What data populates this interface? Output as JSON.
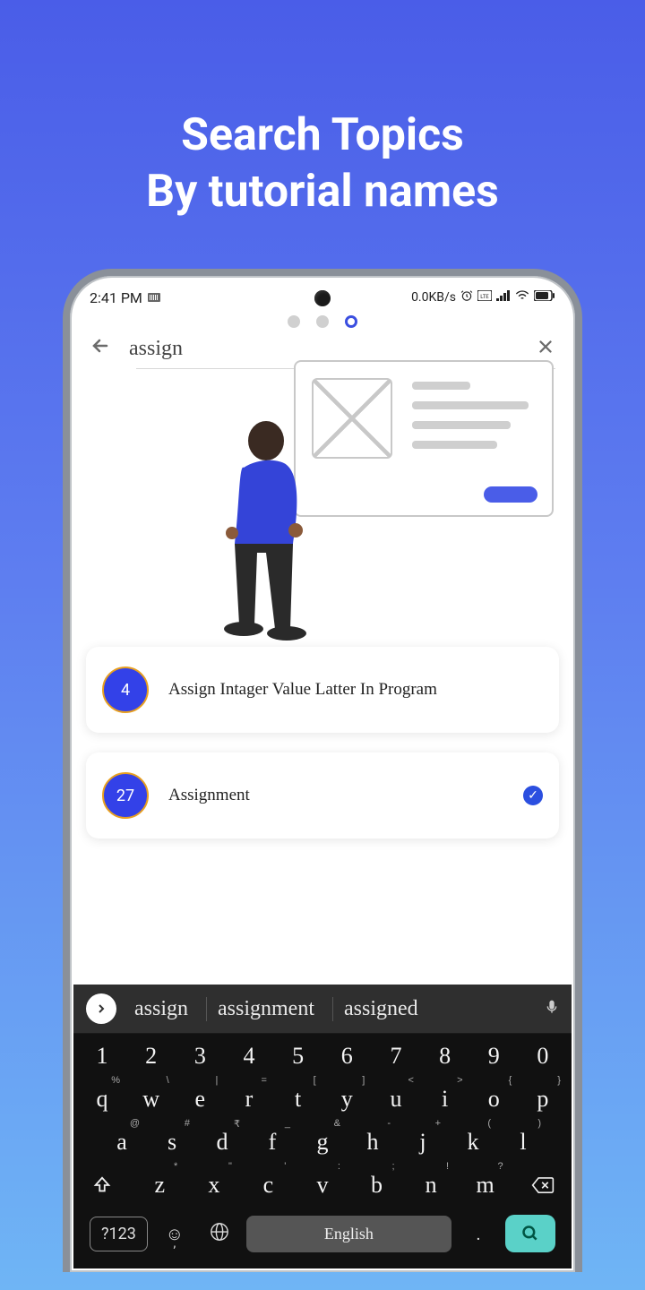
{
  "promo": {
    "line1": "Search Topics",
    "line2": "By tutorial names"
  },
  "status": {
    "time": "2:41 PM",
    "net": "0.0KB/s"
  },
  "search": {
    "query": "assign"
  },
  "results": [
    {
      "num": "4",
      "title": "Assign Intager Value Latter In Program",
      "done": false
    },
    {
      "num": "27",
      "title": "Assignment",
      "done": true
    }
  ],
  "suggest": [
    "assign",
    "assignment",
    "assigned"
  ],
  "kb": {
    "row_num": [
      "1",
      "2",
      "3",
      "4",
      "5",
      "6",
      "7",
      "8",
      "9",
      "0"
    ],
    "row1": [
      {
        "k": "q",
        "s": "%"
      },
      {
        "k": "w",
        "s": "\\"
      },
      {
        "k": "e",
        "s": "|"
      },
      {
        "k": "r",
        "s": "="
      },
      {
        "k": "t",
        "s": "["
      },
      {
        "k": "y",
        "s": "]"
      },
      {
        "k": "u",
        "s": "<"
      },
      {
        "k": "i",
        "s": ">"
      },
      {
        "k": "o",
        "s": "{"
      },
      {
        "k": "p",
        "s": "}"
      }
    ],
    "row2": [
      {
        "k": "a",
        "s": "@"
      },
      {
        "k": "s",
        "s": "#"
      },
      {
        "k": "d",
        "s": "₹"
      },
      {
        "k": "f",
        "s": "_"
      },
      {
        "k": "g",
        "s": "&"
      },
      {
        "k": "h",
        "s": "-"
      },
      {
        "k": "j",
        "s": "+"
      },
      {
        "k": "k",
        "s": "("
      },
      {
        "k": "l",
        "s": ")"
      }
    ],
    "row3": [
      {
        "k": "z",
        "s": "*"
      },
      {
        "k": "x",
        "s": "\""
      },
      {
        "k": "c",
        "s": "'"
      },
      {
        "k": "v",
        "s": ":"
      },
      {
        "k": "b",
        "s": ";"
      },
      {
        "k": "n",
        "s": "!"
      },
      {
        "k": "m",
        "s": "?"
      }
    ],
    "sym": "?123",
    "space": "English",
    "period": "."
  }
}
